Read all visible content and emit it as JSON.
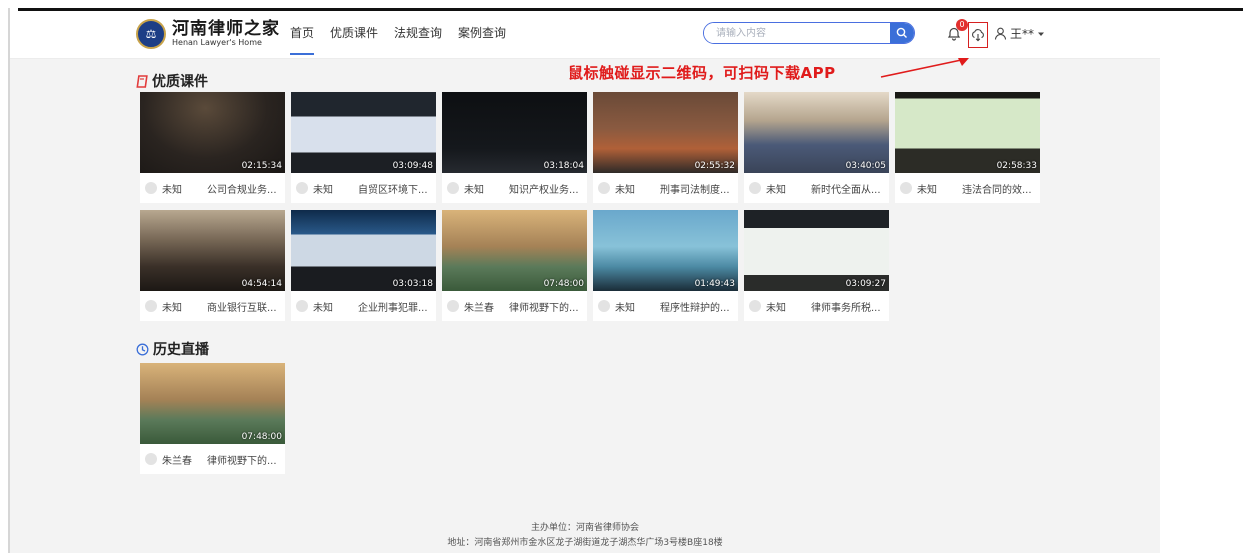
{
  "header": {
    "logo_cn": "河南律师之家",
    "logo_en": "Henan Lawyer's Home",
    "nav": [
      "首页",
      "优质课件",
      "法规查询",
      "案例查询"
    ],
    "search_placeholder": "请输入内容",
    "notification_count": "0",
    "username": "王**"
  },
  "annotation": "鼠标触碰显示二维码，可扫码下载APP",
  "sections": {
    "courses_title": "优质课件",
    "history_title": "历史直播"
  },
  "courses": [
    {
      "duration": "02:15:34",
      "author": "未知",
      "title": "公司合规业务..."
    },
    {
      "duration": "03:09:48",
      "author": "未知",
      "title": "自贸区环境下..."
    },
    {
      "duration": "03:18:04",
      "author": "未知",
      "title": "知识产权业务..."
    },
    {
      "duration": "02:55:32",
      "author": "未知",
      "title": "刑事司法制度..."
    },
    {
      "duration": "03:40:05",
      "author": "未知",
      "title": "新时代全面从..."
    },
    {
      "duration": "02:58:33",
      "author": "未知",
      "title": "违法合同的效..."
    },
    {
      "duration": "04:54:14",
      "author": "未知",
      "title": "商业银行互联..."
    },
    {
      "duration": "03:03:18",
      "author": "未知",
      "title": "企业刑事犯罪..."
    },
    {
      "duration": "07:48:00",
      "author": "朱兰春",
      "title": "律师视野下的..."
    },
    {
      "duration": "01:49:43",
      "author": "未知",
      "title": "程序性辩护的..."
    },
    {
      "duration": "03:09:27",
      "author": "未知",
      "title": "律师事务所税..."
    }
  ],
  "history": [
    {
      "duration": "07:48:00",
      "author": "朱兰春",
      "title": "律师视野下的..."
    }
  ],
  "footer": {
    "line1": "主办单位：河南省律师协会",
    "line2": "地址：河南省郑州市金水区龙子湖街道龙子湖杰华广场3号楼B座18楼"
  },
  "colors": {
    "accent": "#3b6fd8",
    "annotation_red": "#e01b1b",
    "section_icon_red": "#e23b3b",
    "history_icon_blue": "#3b6fd8"
  },
  "icons": [
    "search-icon",
    "bell-icon",
    "download-icon",
    "user-icon",
    "chevron-down-icon",
    "book-icon",
    "clock-icon"
  ]
}
